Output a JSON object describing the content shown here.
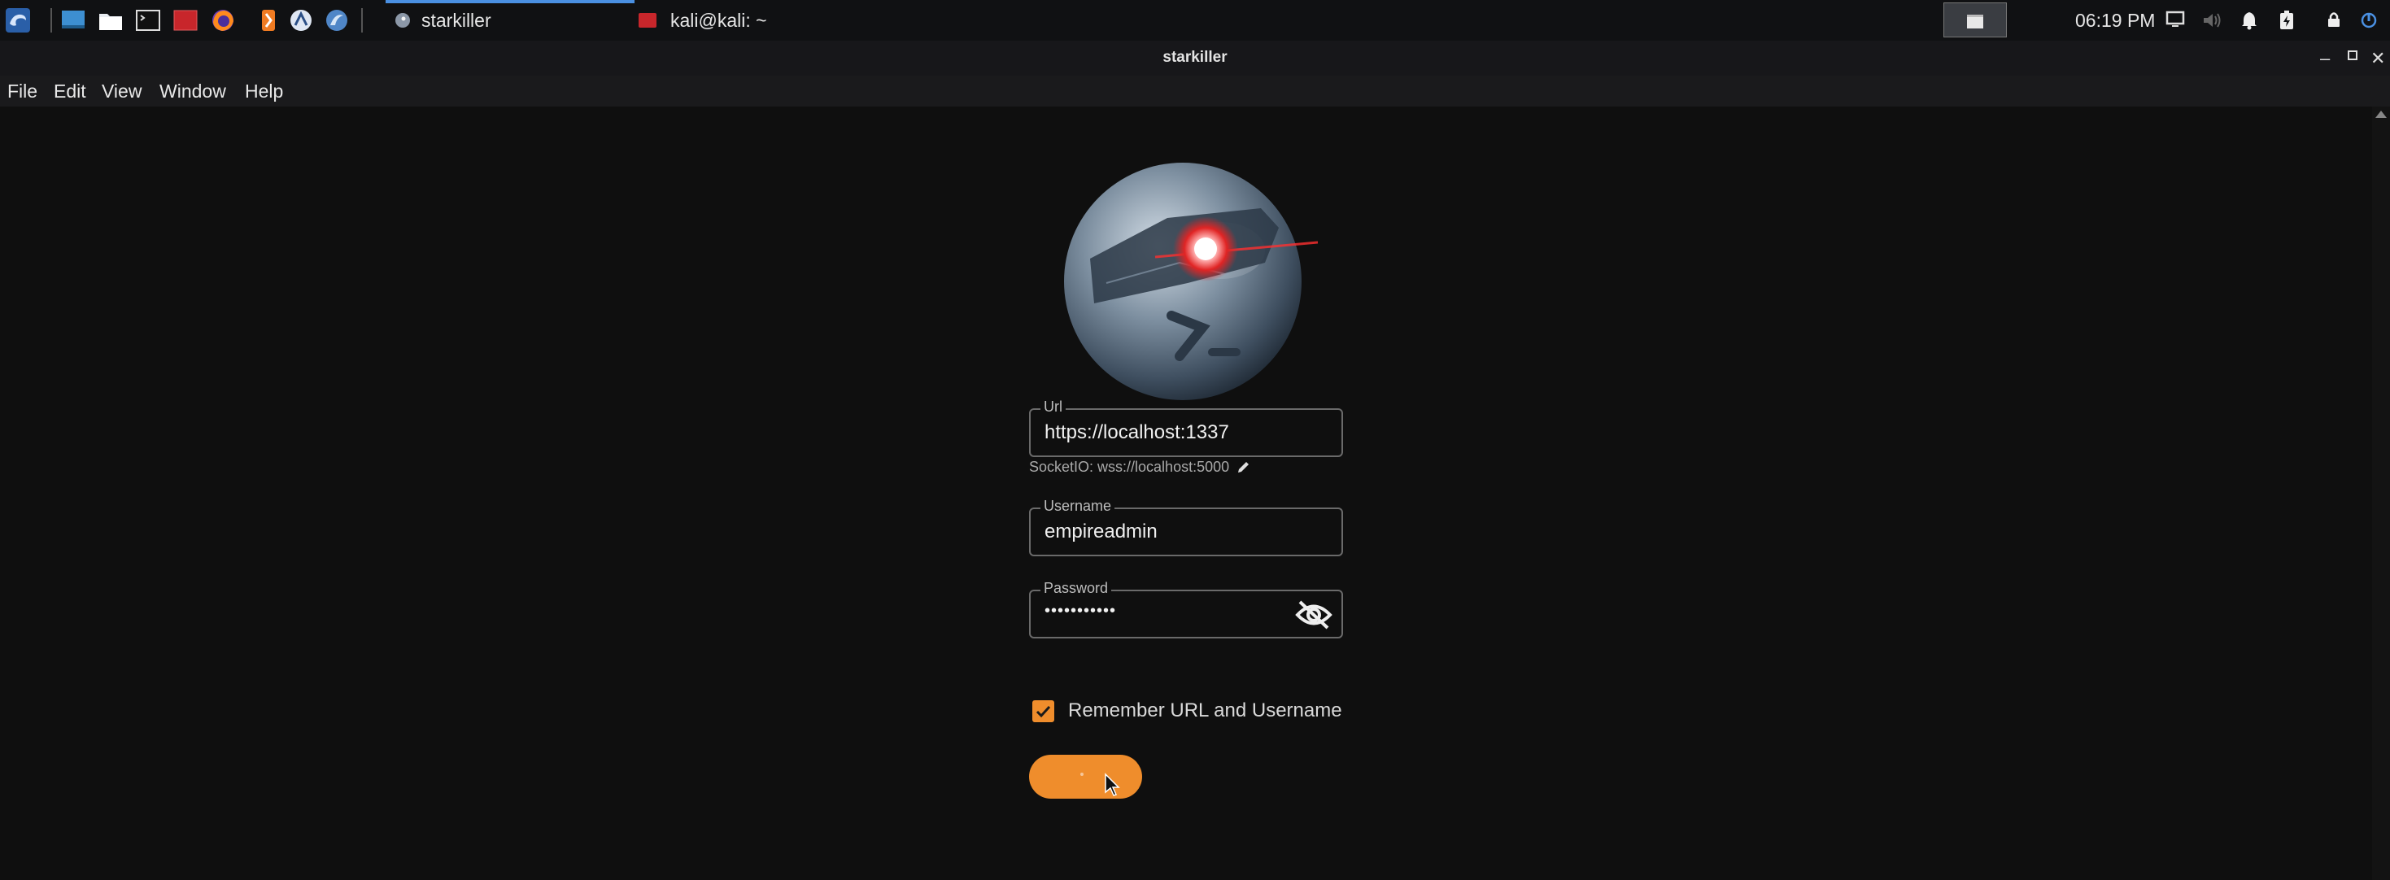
{
  "taskbar": {
    "tasks": [
      {
        "label": "starkiller",
        "active": true
      },
      {
        "label": "kali@kali: ~",
        "active": false
      }
    ],
    "clock": "06:19 PM"
  },
  "window": {
    "title": "starkiller"
  },
  "menu": {
    "items": [
      "File",
      "Edit",
      "View",
      "Window",
      "Help"
    ]
  },
  "login": {
    "url_label": "Url",
    "url_value": "https://localhost:1337",
    "socket_text": "SocketIO: wss://localhost:5000",
    "username_label": "Username",
    "username_value": "empireadmin",
    "password_label": "Password",
    "password_value": "•••••••••••",
    "remember_label": "Remember URL and Username",
    "remember_checked": true
  },
  "colors": {
    "accent": "#ef8d2c",
    "background": "#0f0f0f",
    "taskbar": "#101113",
    "active_task_indicator": "#4a90e2"
  },
  "icons": {
    "app_menu": "kali-dragon-icon",
    "apps": [
      "show-desktop-icon",
      "file-manager-icon",
      "terminal-icon",
      "red-app-icon",
      "firefox-icon",
      "burp-icon",
      "metasploit-icon",
      "wireshark-icon"
    ],
    "tray": [
      "display-icon",
      "volume-icon",
      "bell-icon",
      "battery-icon",
      "lock-icon",
      "power-icon"
    ]
  }
}
